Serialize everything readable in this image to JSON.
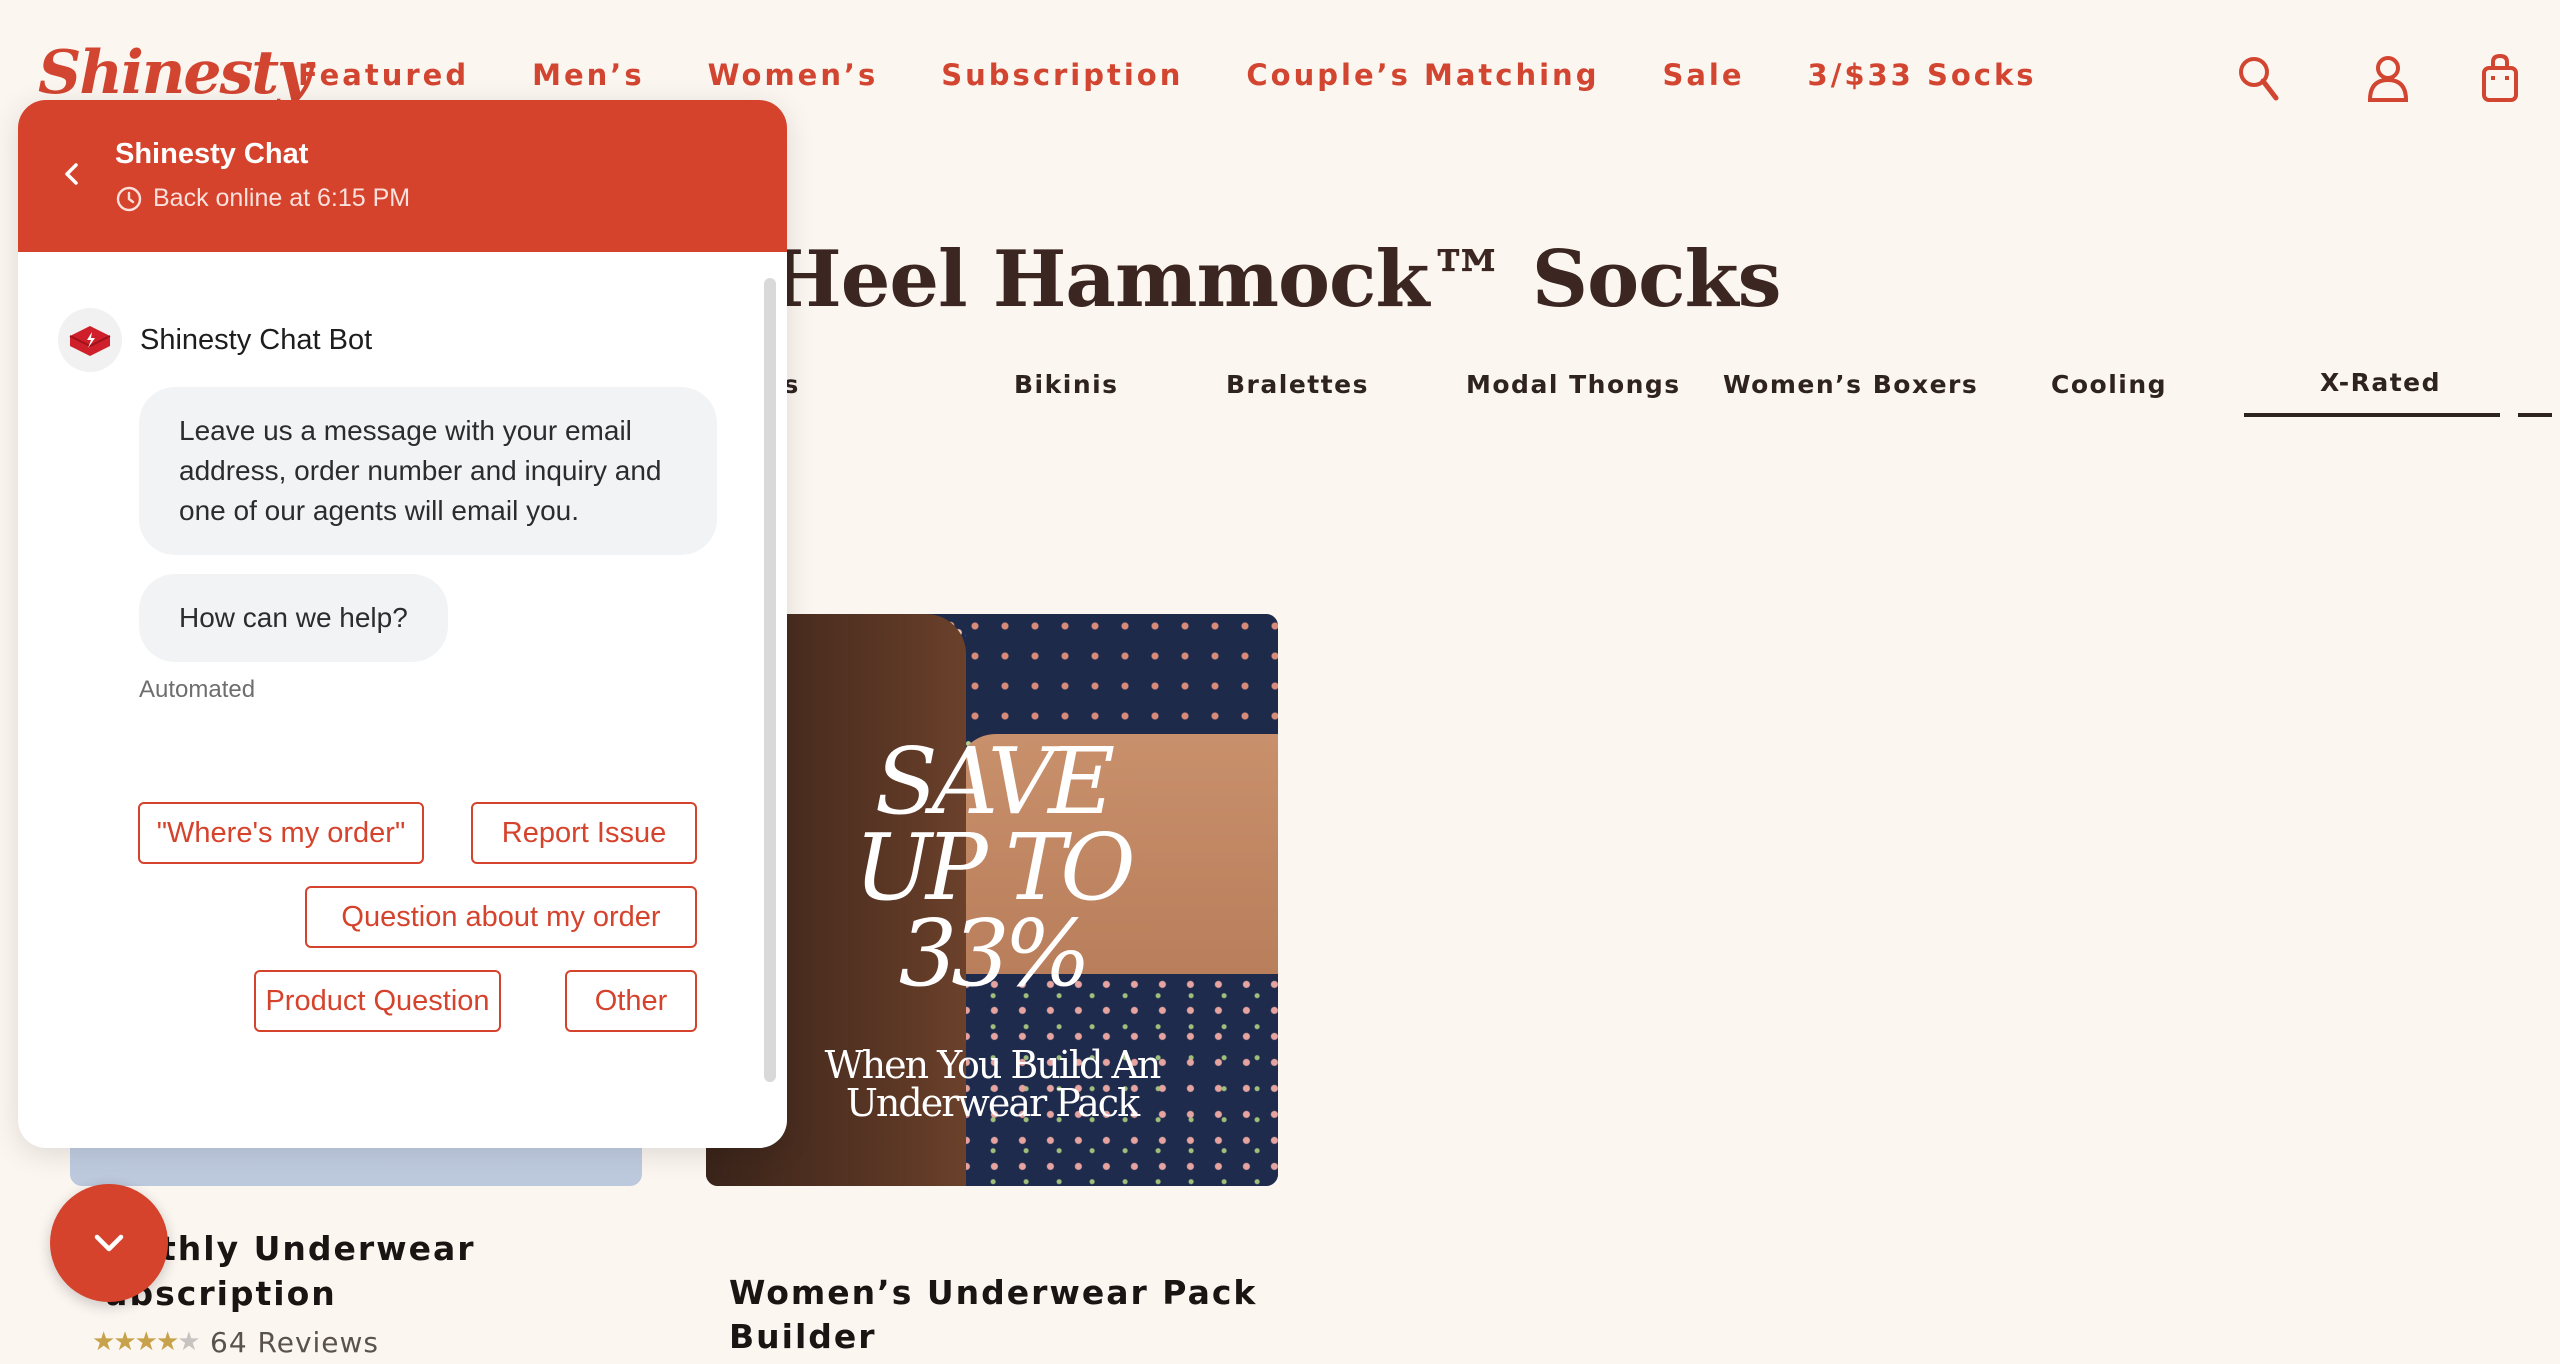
{
  "brand": {
    "logo": "Shinesty"
  },
  "nav": {
    "items": [
      {
        "label": "Featured"
      },
      {
        "label": "Men’s"
      },
      {
        "label": "Women’s"
      },
      {
        "label": "Subscription"
      },
      {
        "label": "Couple’s Matching"
      },
      {
        "label": "Sale"
      },
      {
        "label": "3/$33 Socks"
      }
    ]
  },
  "header_icons": [
    "search-icon",
    "account-icon",
    "cart-icon"
  ],
  "page": {
    "title": "Heel Hammock™ Socks"
  },
  "tabs": [
    {
      "label": "ts"
    },
    {
      "label": "Bikinis"
    },
    {
      "label": "Bralettes"
    },
    {
      "label": "Modal Thongs"
    },
    {
      "label": "Women’s Boxers"
    },
    {
      "label": "Cooling"
    },
    {
      "label": "X-Rated",
      "active": true
    }
  ],
  "promo": {
    "line1": "SAVE",
    "line2": "UP TO",
    "line3": "33%",
    "sub1": "When You Build An",
    "sub2": "Underwear Pack"
  },
  "products": [
    {
      "title_line1": "thly Underwear",
      "title_line2": "ubscription",
      "rating": 4,
      "reviews": "64 Reviews"
    },
    {
      "title_line1": "Women’s Underwear Pack",
      "title_line2": "Builder"
    }
  ],
  "chat": {
    "title": "Shinesty Chat",
    "status": "Back online at 6:15 PM",
    "bot_name": "Shinesty Chat Bot",
    "messages": [
      "Leave us a message with your email address, order number and inquiry and one of our agents will email you.",
      "How can we help?"
    ],
    "meta": "Automated",
    "quick_replies": [
      "\"Where's my order\"",
      "Report Issue",
      "Question about my order",
      "Product Question",
      "Other"
    ]
  },
  "colors": {
    "brand": "#d5432d",
    "background": "#fcf6f1",
    "text": "#2f2320"
  }
}
